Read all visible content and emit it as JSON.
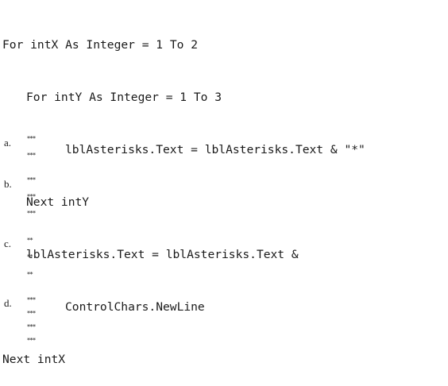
{
  "code": {
    "lines": [
      "For intX As Integer = 1 To 2",
      "For intY As Integer = 1 To 3",
      "lblAsterisks.Text = lblAsterisks.Text & \"*\"",
      "Next intY",
      "lblAsterisks.Text = lblAsterisks.Text &",
      "ControlChars.NewLine",
      "Next intX"
    ]
  },
  "options": [
    {
      "letter": "a.",
      "lines": [
        "***",
        "***"
      ]
    },
    {
      "letter": "b.",
      "lines": [
        "***",
        "***",
        "***"
      ]
    },
    {
      "letter": "c.",
      "lines": [
        "**",
        "**",
        "**"
      ]
    },
    {
      "letter": "d.",
      "lines": [
        "***",
        "***",
        "***",
        "***"
      ]
    }
  ]
}
